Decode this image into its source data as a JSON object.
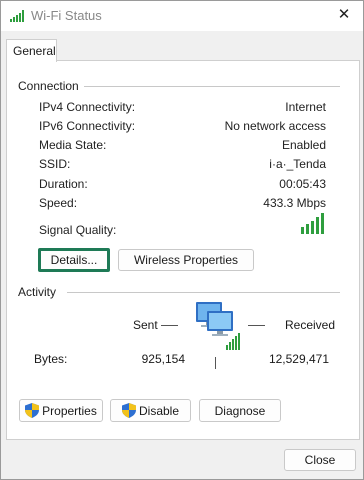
{
  "window": {
    "title": "Wi-Fi Status",
    "close_glyph": "✕"
  },
  "tabs": [
    {
      "label": "General"
    }
  ],
  "connection": {
    "heading": "Connection",
    "rows": [
      {
        "label": "IPv4 Connectivity:",
        "value": "Internet"
      },
      {
        "label": "IPv6 Connectivity:",
        "value": "No network access"
      },
      {
        "label": "Media State:",
        "value": "Enabled"
      },
      {
        "label": "SSID:",
        "value": "i·a·_Tenda"
      },
      {
        "label": "Duration:",
        "value": "00:05:43"
      },
      {
        "label": "Speed:",
        "value": "433.3 Mbps"
      }
    ],
    "signal_label": "Signal Quality:",
    "signal_bars": 5,
    "details_button": "Details...",
    "wireless_button": "Wireless Properties"
  },
  "activity": {
    "heading": "Activity",
    "sent_label": "Sent",
    "received_label": "Received",
    "bytes_label": "Bytes:",
    "bytes_sent": "925,154",
    "bytes_received": "12,529,471"
  },
  "buttons": {
    "properties": "Properties",
    "disable": "Disable",
    "diagnose": "Diagnose",
    "close": "Close"
  },
  "colors": {
    "signal_green": "#2e9e3e",
    "focus_green": "#1e7a56",
    "shield_blue": "#2d6fd1",
    "shield_yellow": "#f2c21b"
  },
  "icons": {
    "title": "wifi-signal-icon",
    "network": "network-computers-icon",
    "shield": "uac-shield-icon"
  }
}
